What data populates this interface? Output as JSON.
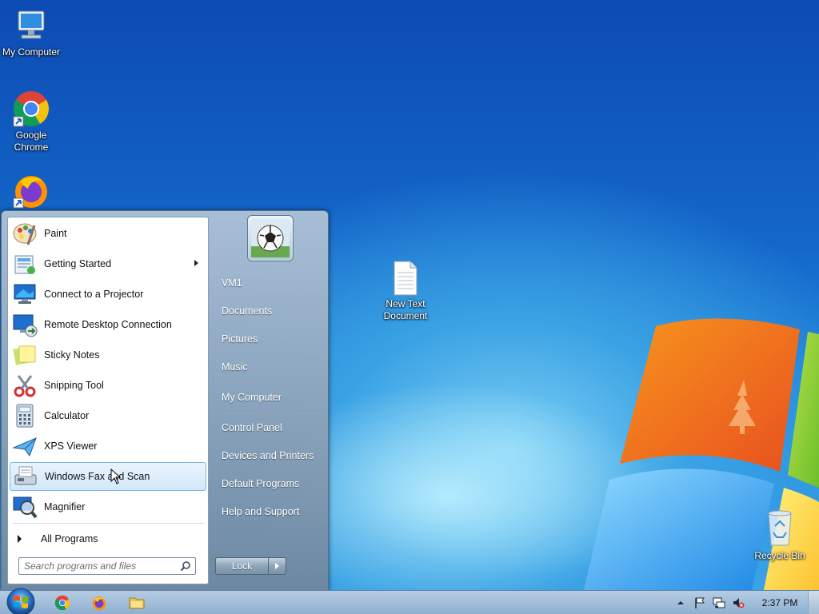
{
  "desktop": {
    "icons": [
      {
        "label": "My Computer",
        "icon": "computer-icon"
      },
      {
        "label": "Google Chrome",
        "icon": "chrome-icon"
      },
      {
        "label": "",
        "icon": "firefox-icon"
      },
      {
        "label": "New Text Document",
        "icon": "text-document-icon"
      },
      {
        "label": "Recycle Bin",
        "icon": "recycle-bin-icon"
      }
    ]
  },
  "start_menu": {
    "programs": [
      {
        "label": "Paint",
        "icon": "paint-icon",
        "has_submenu": false
      },
      {
        "label": "Getting Started",
        "icon": "getting-started-icon",
        "has_submenu": true
      },
      {
        "label": "Connect to a Projector",
        "icon": "projector-icon",
        "has_submenu": false
      },
      {
        "label": "Remote Desktop Connection",
        "icon": "remote-desktop-icon",
        "has_submenu": false
      },
      {
        "label": "Sticky Notes",
        "icon": "sticky-notes-icon",
        "has_submenu": false
      },
      {
        "label": "Snipping Tool",
        "icon": "scissors-icon",
        "has_submenu": false
      },
      {
        "label": "Calculator",
        "icon": "calculator-icon",
        "has_submenu": false
      },
      {
        "label": "XPS Viewer",
        "icon": "xps-viewer-icon",
        "has_submenu": false
      },
      {
        "label": "Windows Fax and Scan",
        "icon": "fax-scan-icon",
        "has_submenu": false,
        "highlighted": true
      },
      {
        "label": "Magnifier",
        "icon": "magnifier-icon",
        "has_submenu": false
      }
    ],
    "all_programs_label": "All Programs",
    "search": {
      "placeholder": "Search programs and files",
      "value": ""
    },
    "user_avatar": "soccer-ball-avatar",
    "places": [
      {
        "label": "VM1"
      },
      {
        "label": "Documents"
      },
      {
        "label": "Pictures"
      },
      {
        "label": "Music"
      },
      {
        "label": "My Computer"
      },
      {
        "label": "Control Panel"
      },
      {
        "label": "Devices and Printers"
      },
      {
        "label": "Default Programs"
      },
      {
        "label": "Help and Support"
      }
    ],
    "lock_label": "Lock"
  },
  "taskbar": {
    "pinned": [
      {
        "name": "chrome-icon"
      },
      {
        "name": "firefox-icon"
      },
      {
        "name": "file-explorer-icon"
      }
    ],
    "tray": {
      "icons": [
        "show-hidden-icons-arrow",
        "action-center-flag-icon",
        "network-icon",
        "volume-muted-icon"
      ],
      "time": "2:37 PM"
    }
  },
  "colors": {
    "desktop_blue": "#1466c9",
    "highlight_border": "#7eb4ea",
    "menu_glass": "#8ea5ba"
  }
}
